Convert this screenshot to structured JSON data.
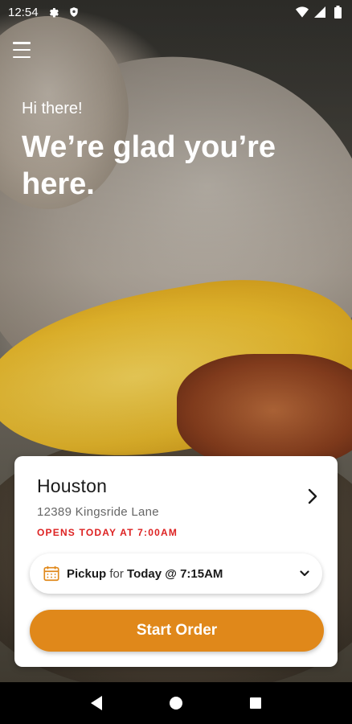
{
  "status_bar": {
    "time": "12:54",
    "icons": [
      "gear-icon",
      "shield-icon",
      "wifi-icon",
      "signal-icon",
      "battery-icon"
    ]
  },
  "header": {
    "menu_icon": "hamburger-menu-icon"
  },
  "hero": {
    "greeting": "Hi there!",
    "headline": "We’re glad you’re here."
  },
  "location": {
    "name": "Houston",
    "address": "12389 Kingsride Lane",
    "hours": "OPENS TODAY AT 7:00AM",
    "hours_color": "#dd2222"
  },
  "pickup": {
    "mode": "Pickup",
    "for_label": "for",
    "time": "Today @ 7:15AM"
  },
  "actions": {
    "start_order": "Start Order",
    "accent_color": "#e0881a"
  },
  "nav": {
    "icons": [
      "back-icon",
      "home-icon",
      "recents-icon"
    ]
  }
}
